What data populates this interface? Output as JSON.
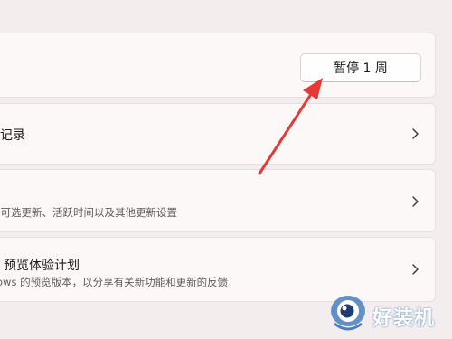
{
  "windows_update": {
    "pause_button_label": "暂停 1 周",
    "history_title": "记录",
    "advanced_subtitle": "、可选更新、活跃时间以及其他更新设置",
    "insider_title": "预览体验计划",
    "insider_subtitle": "ows 的预览版本，以分享有关新功能和更新的反馈"
  },
  "icons": {
    "chevron": "chevron-right-icon",
    "annotation": "red-arrow-annotation",
    "watermark_logo": "eye-logo-icon"
  },
  "watermark": {
    "text": "好装机"
  },
  "colors": {
    "background": "#f3eeed",
    "card": "#fbf8f7",
    "arrow": "#e53935",
    "watermark": "#4a7fc1"
  }
}
